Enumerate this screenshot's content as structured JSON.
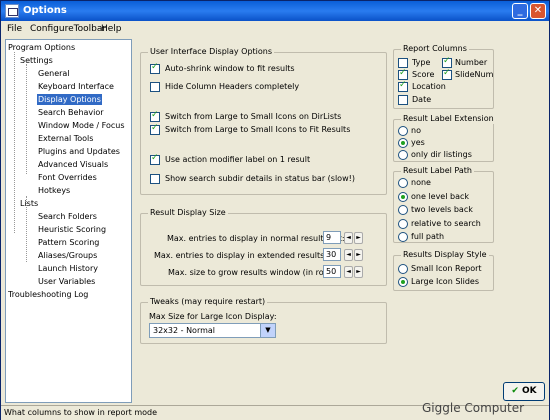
{
  "window": {
    "title": "Options",
    "min_glyph": "_",
    "close_glyph": "✕"
  },
  "menu": [
    "File",
    "ConfigureToolbar",
    "Help"
  ],
  "tree": {
    "program_options": "Program Options",
    "settings": "Settings",
    "settings_items": [
      "General",
      "Keyboard Interface",
      "Display Options",
      "Search Behavior",
      "Window Mode / Focus",
      "External Tools",
      "Plugins and Updates",
      "Advanced Visuals",
      "Font Overrides",
      "Hotkeys"
    ],
    "selected": "Display Options",
    "lists": "Lists",
    "lists_items": [
      "Search Folders",
      "Heuristic Scoring",
      "Pattern Scoring",
      "Aliases/Groups",
      "Launch History",
      "User Variables"
    ],
    "troubleshooting": "Troubleshooting Log"
  },
  "ui_display": {
    "title": "User Interface Display Options",
    "options": [
      {
        "label": "Auto-shrink window to fit results",
        "checked": true
      },
      {
        "label": "Hide Column Headers completely",
        "checked": false
      },
      {
        "label": "Switch from Large to Small Icons on DirLists",
        "checked": true
      },
      {
        "label": "Switch from Large to Small Icons to Fit Results",
        "checked": true
      },
      {
        "label": "Use action modifier label on 1 result",
        "checked": true
      },
      {
        "label": "Show search subdir details in status bar (slow!)",
        "checked": false
      }
    ]
  },
  "result_size": {
    "title": "Result Display Size",
    "rows": [
      {
        "label": "Max. entries to display in normal results list:",
        "value": "9"
      },
      {
        "label": "Max. entries to display in extended results list:",
        "value": "30"
      },
      {
        "label": "Max. size to grow results window (in rows):",
        "value": "50"
      }
    ],
    "spin_left": "◄",
    "spin_right": "►"
  },
  "tweaks": {
    "title": "Tweaks (may require restart)",
    "label": "Max Size for Large Icon Display:",
    "selected": "32x32 - Normal",
    "arrow": "▼"
  },
  "report_columns": {
    "title": "Report Columns",
    "items": [
      {
        "label": "Type",
        "checked": false
      },
      {
        "label": "Number",
        "checked": true
      },
      {
        "label": "Score",
        "checked": true
      },
      {
        "label": "SlideNum",
        "checked": true
      },
      {
        "label": "Location",
        "checked": true
      },
      {
        "label": "Date",
        "checked": false
      }
    ]
  },
  "label_extension": {
    "title": "Result Label Extension",
    "options": [
      "no",
      "yes",
      "only dir listings"
    ],
    "selected": "yes"
  },
  "label_path": {
    "title": "Result Label Path",
    "options": [
      "none",
      "one level back",
      "two levels back",
      "relative to search",
      "full path"
    ],
    "selected": "one level back"
  },
  "display_style": {
    "title": "Results Display Style",
    "options": [
      "Small Icon Report",
      "Large Icon Slides"
    ],
    "selected": "Large Icon Slides"
  },
  "ok": {
    "label": "OK",
    "icon": "✔"
  },
  "status": "What columns to show in report mode",
  "watermark": "Giggle Computer"
}
